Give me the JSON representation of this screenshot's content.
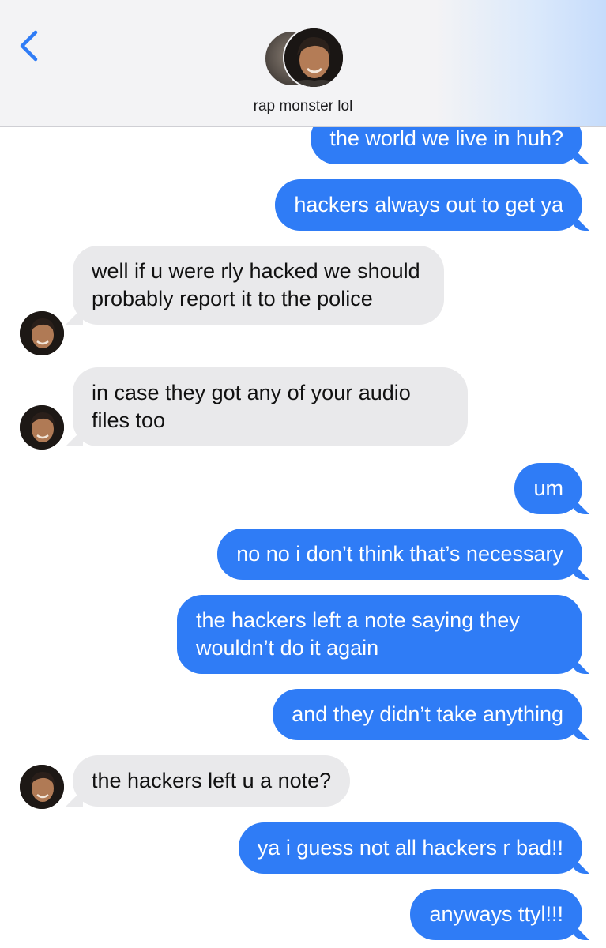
{
  "header": {
    "contact_name": "rap monster lol",
    "back_icon": "chevron-left-icon",
    "accent_color": "#2f7cf6"
  },
  "messages": [
    {
      "side": "out",
      "text": "the world we live in huh?"
    },
    {
      "side": "out",
      "text": "hackers always out to get ya"
    },
    {
      "side": "in",
      "text": "well if u were rly hacked we should probably report it to the police"
    },
    {
      "side": "in",
      "text": "in case they got any of your audio files too"
    },
    {
      "side": "out",
      "text": "um"
    },
    {
      "side": "out",
      "text": "no no i don’t think that’s necessary"
    },
    {
      "side": "out",
      "text": "the hackers left a note saying they wouldn’t do it again"
    },
    {
      "side": "out",
      "text": "and they didn’t take anything"
    },
    {
      "side": "in",
      "text": "the hackers left u a note?"
    },
    {
      "side": "out",
      "text": "ya i guess not all hackers r bad!!"
    },
    {
      "side": "out",
      "text": "anyways ttyl!!!"
    }
  ],
  "colors": {
    "outgoing_bubble": "#2f7cf6",
    "incoming_bubble": "#e9e9eb",
    "header_background": "#f3f3f5"
  }
}
